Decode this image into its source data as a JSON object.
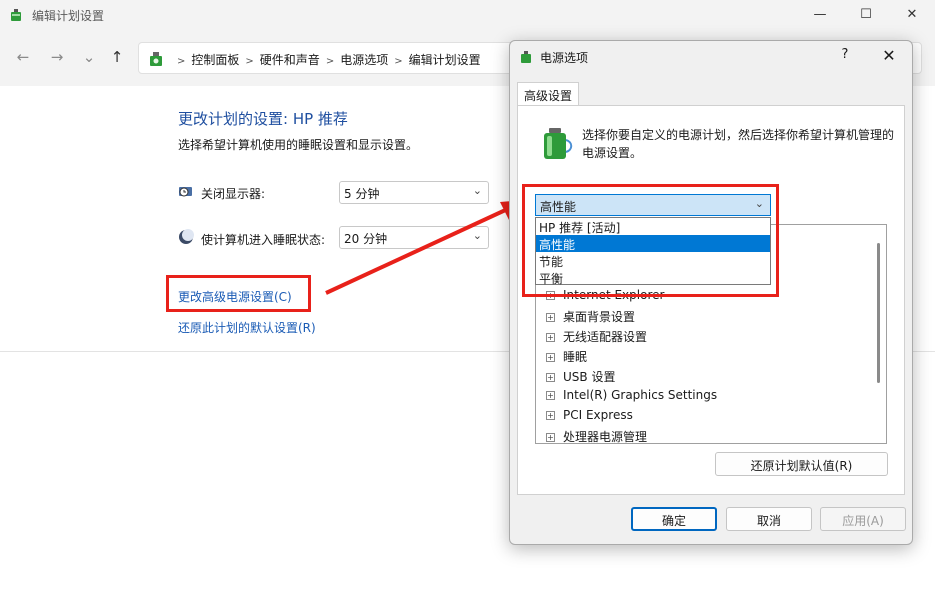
{
  "main_window": {
    "title": "编辑计划设置",
    "controls": {
      "minimize": "—",
      "maximize": "☐",
      "close": "✕"
    },
    "nav": {
      "back": "←",
      "forward": "→",
      "recent": "⌄",
      "up": "↑"
    },
    "breadcrumbs": [
      "控制面板",
      "硬件和声音",
      "电源选项",
      "编辑计划设置"
    ],
    "page_title": "更改计划的设置: HP 推荐",
    "page_subtitle": "选择希望计算机使用的睡眠设置和显示设置。",
    "settings": [
      {
        "label": "关闭显示器:",
        "value": "5 分钟",
        "icon": "monitor-clock-icon"
      },
      {
        "label": "使计算机进入睡眠状态:",
        "value": "20 分钟",
        "icon": "moon-icon"
      }
    ],
    "links": {
      "advanced": "更改高级电源设置(C)",
      "restore": "还原此计划的默认设置(R)"
    }
  },
  "dialog": {
    "title": "电源选项",
    "help": "?",
    "close": "✕",
    "tab": "高级设置",
    "description": "选择你要自定义的电源计划，然后选择你希望计算机管理的电源设置。",
    "plan_selected": "高性能",
    "plan_options": [
      "HP 推荐 [活动]",
      "高性能",
      "节能",
      "平衡"
    ],
    "tree_items": [
      "Internet Explorer",
      "桌面背景设置",
      "无线适配器设置",
      "睡眠",
      "USB 设置",
      "Intel(R) Graphics Settings",
      "PCI Express",
      "处理器电源管理"
    ],
    "restore_button": "还原计划默认值(R)",
    "buttons": {
      "ok": "确定",
      "cancel": "取消",
      "apply": "应用(A)"
    }
  },
  "colors": {
    "annotation": "#e8211a",
    "accent": "#0078d4",
    "link": "#1a5bb5"
  }
}
